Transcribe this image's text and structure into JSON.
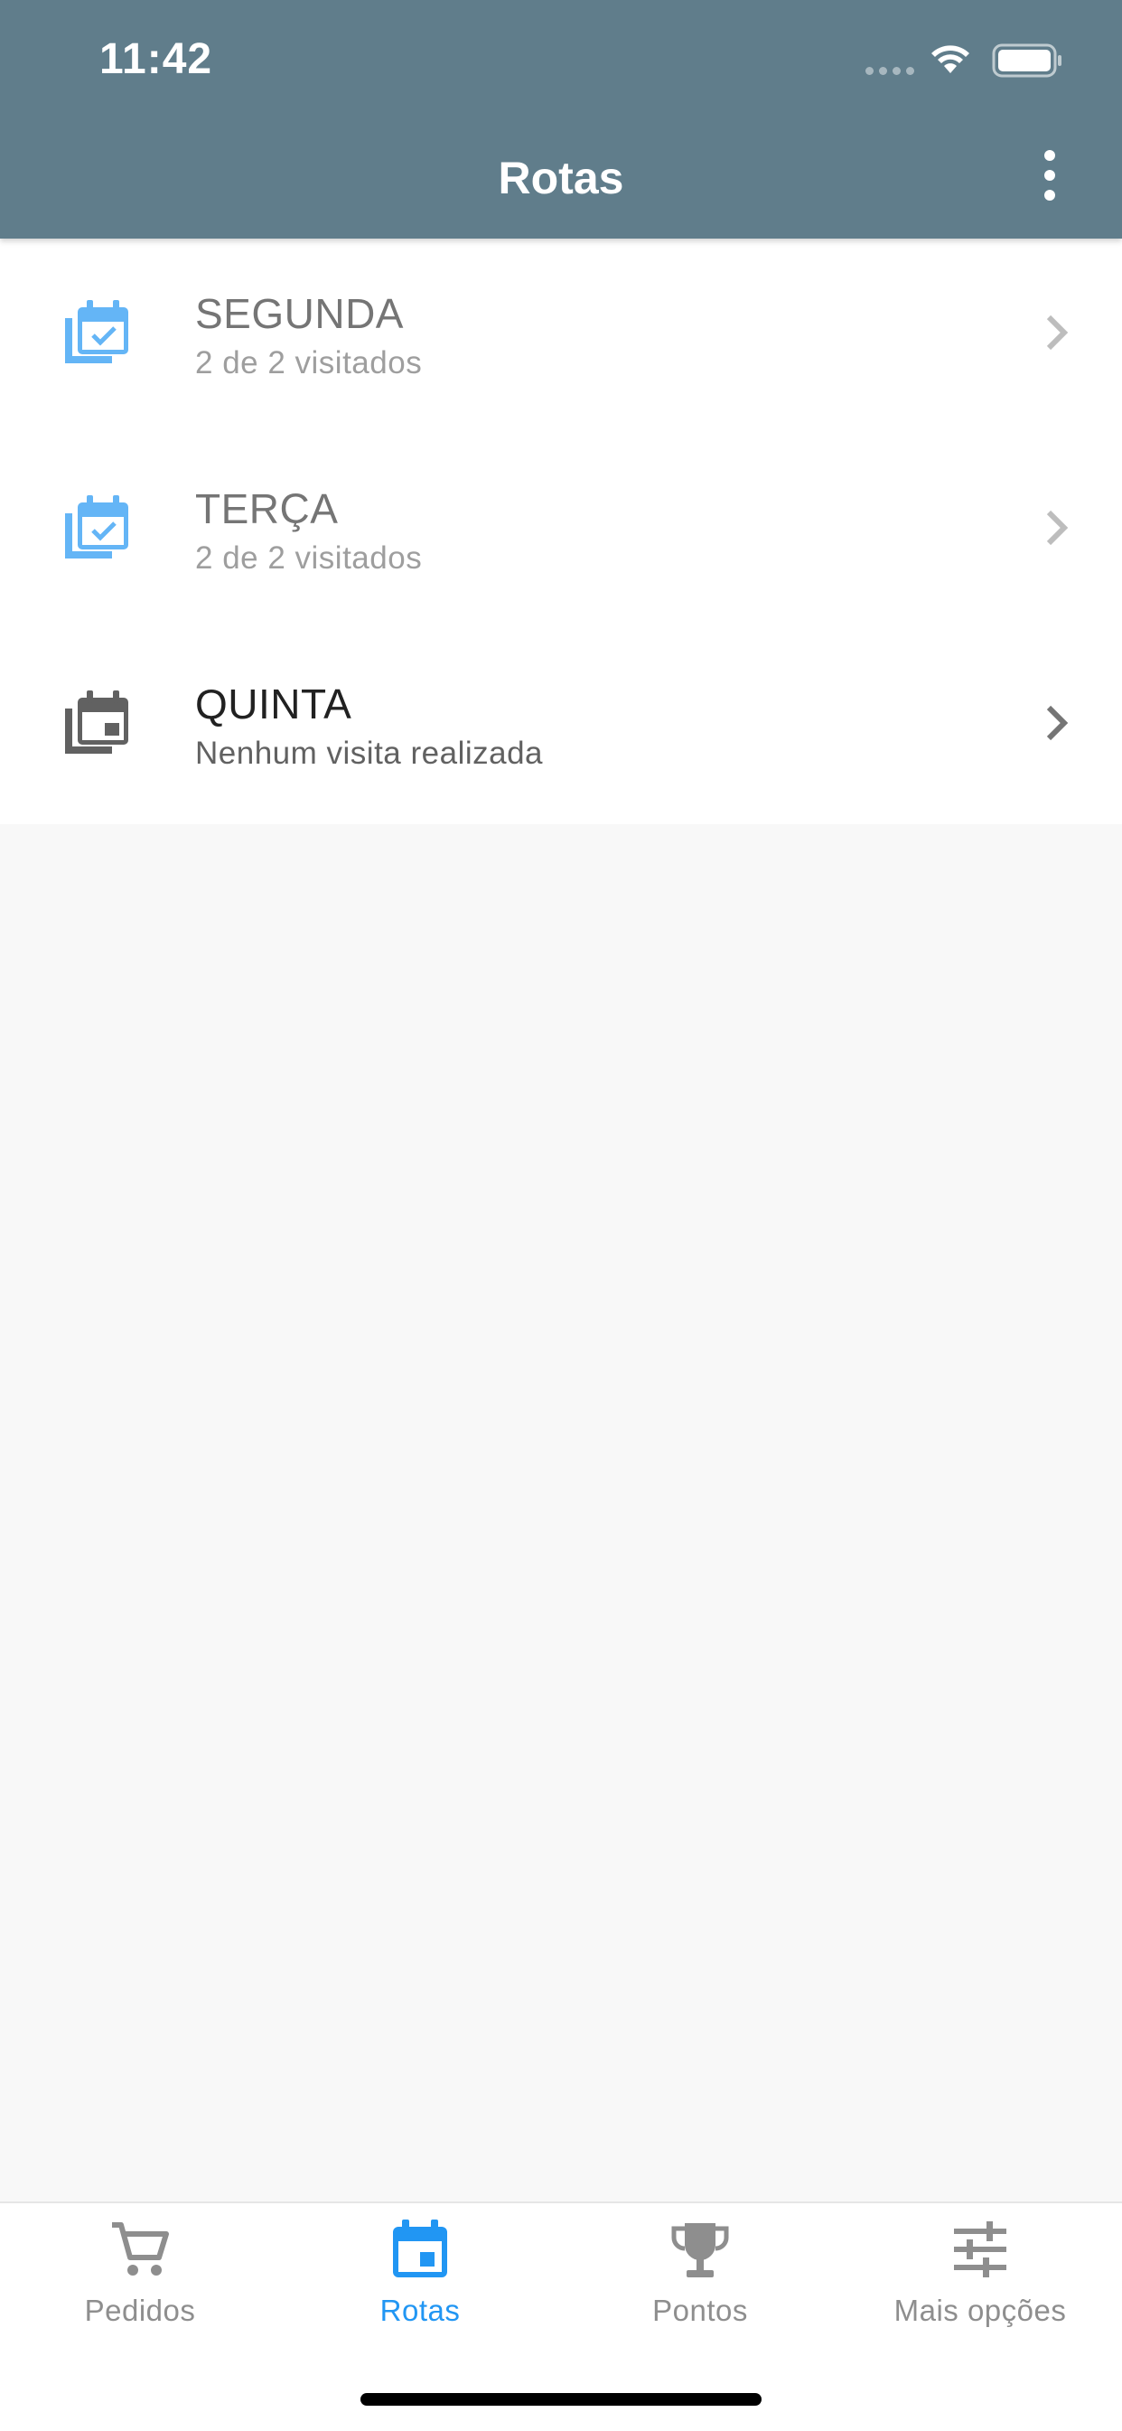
{
  "status_bar": {
    "time": "11:42"
  },
  "header": {
    "title": "Rotas",
    "more_icon": "more-vert-icon"
  },
  "routes": [
    {
      "day": "SEGUNDA",
      "status": "2 de 2 visitados",
      "icon": "calendar-check-icon",
      "completed": true
    },
    {
      "day": "TERÇA",
      "status": "2 de 2 visitados",
      "icon": "calendar-check-icon",
      "completed": true
    },
    {
      "day": "QUINTA",
      "status": "Nenhum visita realizada",
      "icon": "calendar-event-icon",
      "completed": false
    }
  ],
  "tabbar": {
    "tabs": [
      {
        "label": "Pedidos",
        "icon": "cart-icon"
      },
      {
        "label": "Rotas",
        "icon": "calendar-icon",
        "active": true
      },
      {
        "label": "Pontos",
        "icon": "trophy-icon"
      },
      {
        "label": "Mais opções",
        "icon": "tune-icon"
      }
    ]
  },
  "colors": {
    "header_bg": "#607d8b",
    "accent": "#2196f3",
    "done_icon": "#64b5f6",
    "pending_icon": "#616161",
    "inactive_tab": "#8e8e8e"
  }
}
